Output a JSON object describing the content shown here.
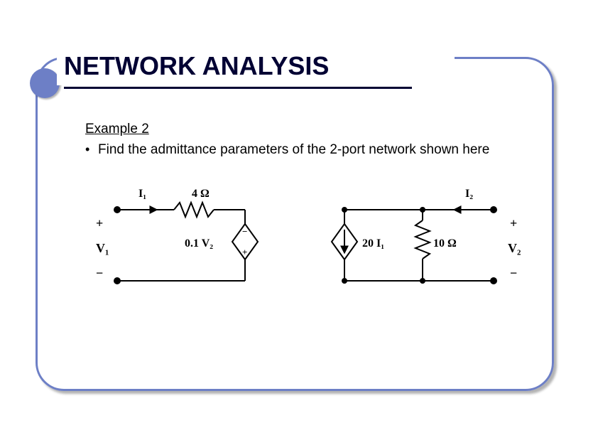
{
  "title": "NETWORK ANALYSIS",
  "example_label": "Example 2",
  "bullet_text": "Find the admittance parameters of the 2-port network shown here",
  "circuit": {
    "I1": "I₁",
    "I2": "I₂",
    "V1": "V₁",
    "V2": "V₂",
    "R_series": "4 Ω",
    "dep_v": "0.1 V₂",
    "dep_i": "20 I₁",
    "R_out": "10 Ω",
    "plus": "+",
    "minus": "−"
  }
}
